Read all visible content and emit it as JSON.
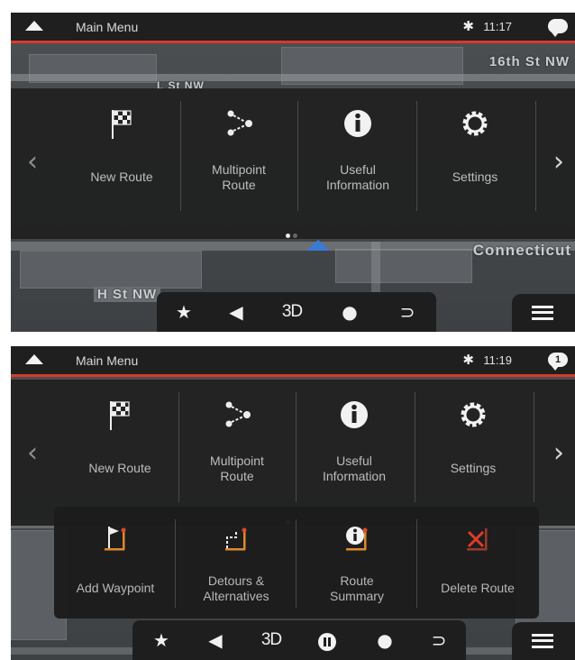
{
  "screens": [
    {
      "status": {
        "title": "Main Menu",
        "bluetooth": "✱",
        "time": "11:17",
        "messages": ""
      },
      "map_streets": [
        "16th St NW",
        "L St NW",
        "Connecticut",
        "H St NW"
      ],
      "menu": {
        "items": [
          {
            "icon": "checkered-flag-icon",
            "label_lines": [
              "New Route"
            ]
          },
          {
            "icon": "multipoint-route-icon",
            "label_lines": [
              "Multipoint",
              "Route"
            ]
          },
          {
            "icon": "info-icon",
            "label_lines": [
              "Useful",
              "Information"
            ]
          },
          {
            "icon": "gear-icon",
            "label_lines": [
              "Settings"
            ]
          }
        ],
        "page_dots": 2,
        "active_dot": 0
      },
      "toolbar": [
        "star-icon",
        "speaker-icon",
        "3D",
        "user-icon",
        "return-icon"
      ],
      "toolbar_text": {
        "view_mode": "3D"
      }
    },
    {
      "status": {
        "title": "Main Menu",
        "bluetooth": "✱",
        "time": "11:19",
        "messages": "1"
      },
      "menu": {
        "items": [
          {
            "icon": "checkered-flag-icon",
            "label_lines": [
              "New Route"
            ]
          },
          {
            "icon": "multipoint-route-icon",
            "label_lines": [
              "Multipoint",
              "Route"
            ]
          },
          {
            "icon": "info-icon",
            "label_lines": [
              "Useful",
              "Information"
            ]
          },
          {
            "icon": "gear-icon",
            "label_lines": [
              "Settings"
            ]
          }
        ],
        "page_dots": 2,
        "active_dot": 0
      },
      "submenu": {
        "items": [
          {
            "icon": "add-waypoint-icon",
            "label_lines": [
              "Add Waypoint"
            ]
          },
          {
            "icon": "detours-icon",
            "label_lines": [
              "Detours &",
              "Alternatives"
            ]
          },
          {
            "icon": "route-summary-icon",
            "label_lines": [
              "Route",
              "Summary"
            ]
          },
          {
            "icon": "delete-route-icon",
            "label_lines": [
              "Delete Route"
            ]
          }
        ]
      },
      "toolbar": [
        "star-icon",
        "speaker-icon",
        "3D",
        "pause-icon",
        "user-icon",
        "return-icon"
      ],
      "toolbar_text": {
        "view_mode": "3D"
      }
    }
  ],
  "colors": {
    "accent_red": "#d83a2a",
    "panel": "#212121",
    "map": "#3e4144"
  }
}
